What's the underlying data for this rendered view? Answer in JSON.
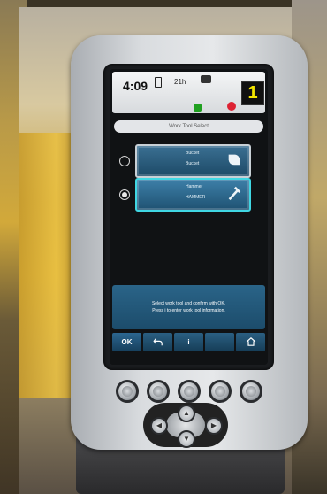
{
  "status_bar": {
    "time": "4:09",
    "hours_label": "21h",
    "gear_display": "1"
  },
  "dialog": {
    "title": "Work Tool Select"
  },
  "tools": [
    {
      "name": "Bucket",
      "sub": "Bucket",
      "selected": false,
      "icon": "bucket-icon"
    },
    {
      "name": "Hammer",
      "sub": "HAMMER",
      "selected": true,
      "icon": "hammer-icon"
    }
  ],
  "info": {
    "line1": "Select work tool and confirm with OK.",
    "line2": "Press i to enter work tool information."
  },
  "softkeys": {
    "ok": "OK",
    "info": "i"
  },
  "colors": {
    "gear_digit": "#f2e400",
    "selected_border": "#40d7e3",
    "panel_blue": "#1f5272"
  }
}
